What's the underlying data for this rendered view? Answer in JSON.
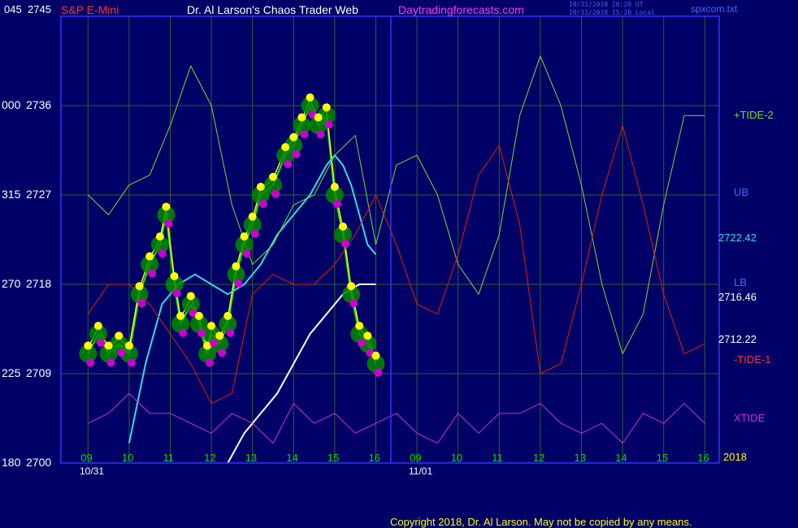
{
  "header": {
    "symbol": "S&P E-Mini",
    "title": "Dr. Al Larson's Chaos Trader Web",
    "site": "Daytradingforecasts.com",
    "stamp1": "10/31/2018 20:20 UT",
    "stamp2": "10/31/2018 15:20 Local",
    "file": "spxcom.txt"
  },
  "copyright": "Copyright 2018, Dr. Al Larson. May not be copied by any means.",
  "colors": {
    "background": "#000066",
    "grid": "#2f5f2f",
    "frame": "#3333ff",
    "price": "#00ff00",
    "yellow": "#ffff00",
    "magenta": "#cc00cc",
    "cyan": "#33dddd",
    "tide2": "#77dd33",
    "tide1": "#dd2200",
    "xtide": "#cc33cc"
  },
  "chart_data": {
    "type": "line",
    "title": "S&P E-Mini",
    "y_axis": {
      "tick_labels": [
        {
          "left": "045",
          "price": "2745"
        },
        {
          "left": "000",
          "price": "2736"
        },
        {
          "left": "315",
          "price": "2727"
        },
        {
          "left": "270",
          "price": "2718"
        },
        {
          "left": "225",
          "price": "2709"
        },
        {
          "left": "180",
          "price": "2700"
        }
      ],
      "ylim": [
        2700,
        2745
      ]
    },
    "x_axis": {
      "day1": "10/31",
      "day2": "11/01",
      "day1_hours": [
        "09",
        "10",
        "11",
        "12",
        "13",
        "14",
        "15",
        "16"
      ],
      "day2_hours": [
        "09",
        "10",
        "11",
        "12",
        "13",
        "14",
        "15",
        "16"
      ],
      "year": "2018"
    },
    "right_labels": {
      "tide2": "+TIDE-2",
      "ub": "UB",
      "ub_value": "2722.42",
      "lb": "LB",
      "lb_value": "2716.46",
      "price_value": "2712.22",
      "tide1": "-TIDE-1",
      "xtide": "XTIDE"
    },
    "series": [
      {
        "name": "price",
        "x": [
          9.0,
          9.25,
          9.5,
          9.75,
          10.0,
          10.25,
          10.5,
          10.75,
          10.9,
          11.1,
          11.25,
          11.5,
          11.7,
          11.9,
          12.0,
          12.2,
          12.4,
          12.6,
          12.8,
          13.0,
          13.2,
          13.5,
          13.8,
          14.0,
          14.2,
          14.4,
          14.6,
          14.8,
          15.0,
          15.2,
          15.4,
          15.6,
          15.8,
          16.0
        ],
        "values": [
          2711,
          2713,
          2711,
          2712,
          2711,
          2717,
          2720,
          2722,
          2725,
          2718,
          2714,
          2716,
          2714,
          2711,
          2713,
          2712,
          2714,
          2719,
          2722,
          2724,
          2727,
          2728,
          2731,
          2732,
          2734,
          2736,
          2734,
          2735,
          2727,
          2723,
          2717,
          2713,
          2712,
          2710
        ]
      },
      {
        "name": "cyan average",
        "x": [
          10.0,
          10.4,
          10.8,
          11.2,
          11.6,
          12.0,
          12.4,
          12.8,
          13.2,
          13.6,
          14.0,
          14.4,
          14.8,
          15.0,
          15.2,
          15.4,
          15.6,
          15.8,
          16.0
        ],
        "values": [
          2702,
          2710,
          2716,
          2718,
          2719,
          2718,
          2717,
          2718,
          2720,
          2723,
          2725,
          2727,
          2730,
          2731,
          2730,
          2728,
          2725,
          2722,
          2721
        ]
      },
      {
        "name": "white average",
        "x": [
          12.4,
          12.8,
          13.2,
          13.6,
          14.0,
          14.4,
          14.8,
          15.2,
          15.6,
          16.0
        ],
        "values": [
          2700,
          2703,
          2705,
          2707,
          2710,
          2713,
          2715,
          2717,
          2718,
          2718
        ]
      },
      {
        "name": "+TIDE-2",
        "x": [
          9.0,
          9.5,
          10.0,
          10.5,
          11.0,
          11.5,
          12.0,
          12.5,
          13.0,
          13.5,
          14.0,
          14.5,
          15.0,
          15.5,
          16.0,
          16.5,
          17.0,
          17.5,
          18.0,
          18.5,
          19.0,
          19.5,
          20.0,
          20.5,
          21.0,
          21.5,
          22.0,
          22.5,
          23.0,
          23.5,
          24.0
        ],
        "values": [
          2727,
          2725,
          2728,
          2729,
          2734,
          2740,
          2736,
          2726,
          2720,
          2722,
          2726,
          2727,
          2731,
          2733,
          2722,
          2730,
          2731,
          2727,
          2720,
          2717,
          2723,
          2735,
          2741,
          2736,
          2728,
          2718,
          2711,
          2715,
          2726,
          2735,
          2735
        ]
      },
      {
        "name": "-TIDE-1",
        "x": [
          9.0,
          9.5,
          10.0,
          10.5,
          11.0,
          11.5,
          12.0,
          12.5,
          13.0,
          13.5,
          14.0,
          14.5,
          15.0,
          15.5,
          16.0,
          16.5,
          17.0,
          17.5,
          18.0,
          18.5,
          19.0,
          19.5,
          20.0,
          20.5,
          21.0,
          21.5,
          22.0,
          22.5,
          23.0,
          23.5,
          24.0
        ],
        "values": [
          2715,
          2718,
          2718,
          2716,
          2713,
          2710,
          2706,
          2707,
          2717,
          2719,
          2718,
          2718,
          2720,
          2723,
          2727,
          2722,
          2716,
          2715,
          2721,
          2729,
          2732,
          2724,
          2709,
          2710,
          2718,
          2727,
          2734,
          2726,
          2717,
          2711,
          2712
        ]
      },
      {
        "name": "XTIDE",
        "x": [
          9.0,
          9.5,
          10.0,
          10.5,
          11.0,
          11.5,
          12.0,
          12.5,
          13.0,
          13.5,
          14.0,
          14.5,
          15.0,
          15.5,
          16.0,
          16.5,
          17.0,
          17.5,
          18.0,
          18.5,
          19.0,
          19.5,
          20.0,
          20.5,
          21.0,
          21.5,
          22.0,
          22.5,
          23.0,
          23.5,
          24.0
        ],
        "values": [
          2704,
          2705,
          2707,
          2705,
          2705,
          2704,
          2703,
          2705,
          2704,
          2702,
          2706,
          2704,
          2705,
          2703,
          2704,
          2705,
          2703,
          2702,
          2705,
          2703,
          2705,
          2705,
          2706,
          2704,
          2703,
          2704,
          2702,
          2705,
          2704,
          2706,
          2704
        ]
      }
    ]
  }
}
